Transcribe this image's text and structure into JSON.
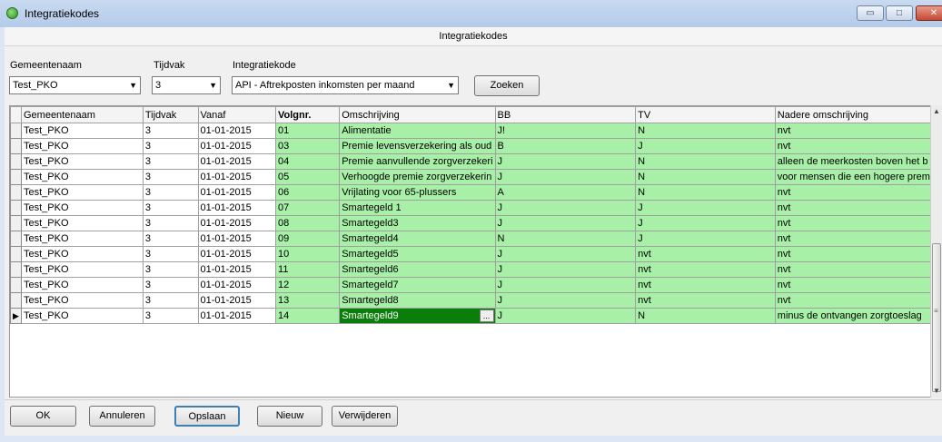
{
  "window": {
    "title": "Integratiekodes",
    "min_glyph": "▭",
    "max_glyph": "□",
    "close_glyph": "✕"
  },
  "header": {
    "title": "Integratiekodes"
  },
  "filters": {
    "gemeente": {
      "label": "Gemeentenaam",
      "value": "Test_PKO"
    },
    "tijdvak": {
      "label": "Tijdvak",
      "value": "3"
    },
    "integratiekode": {
      "label": "Integratiekode",
      "value": "API - Aftrekposten inkomsten per maand"
    },
    "search_label": "Zoeken",
    "dropdown_glyph": "▼"
  },
  "grid": {
    "columns": [
      "Gemeentenaam",
      "Tijdvak",
      "Vanaf",
      "Volgnr.",
      "Omschrijving",
      "BB",
      "TV",
      "Nadere omschrijving"
    ],
    "rows": [
      [
        "Test_PKO",
        "3",
        "01-01-2015",
        "01",
        "Alimentatie",
        "J!",
        "N",
        "nvt"
      ],
      [
        "Test_PKO",
        "3",
        "01-01-2015",
        "03",
        "Premie levensverzekering als oud",
        "B",
        "J",
        "nvt"
      ],
      [
        "Test_PKO",
        "3",
        "01-01-2015",
        "04",
        "Premie aanvullende zorgverzekeri",
        "J",
        "N",
        "alleen de meerkosten boven het b"
      ],
      [
        "Test_PKO",
        "3",
        "01-01-2015",
        "05",
        "Verhoogde premie zorgverzekerin",
        "J",
        "N",
        "voor mensen die een hogere prem"
      ],
      [
        "Test_PKO",
        "3",
        "01-01-2015",
        "06",
        "Vrijlating voor 65-plussers",
        "A",
        "N",
        "nvt"
      ],
      [
        "Test_PKO",
        "3",
        "01-01-2015",
        "07",
        "Smartegeld 1",
        "J",
        "J",
        "nvt"
      ],
      [
        "Test_PKO",
        "3",
        "01-01-2015",
        "08",
        "Smartegeld3",
        "J",
        "J",
        "nvt"
      ],
      [
        "Test_PKO",
        "3",
        "01-01-2015",
        "09",
        "Smartegeld4",
        "N",
        "J",
        "nvt"
      ],
      [
        "Test_PKO",
        "3",
        "01-01-2015",
        "10",
        "Smartegeld5",
        "J",
        "nvt",
        "nvt"
      ],
      [
        "Test_PKO",
        "3",
        "01-01-2015",
        "11",
        "Smartegeld6",
        "J",
        "nvt",
        "nvt"
      ],
      [
        "Test_PKO",
        "3",
        "01-01-2015",
        "12",
        "Smartegeld7",
        "J",
        "nvt",
        "nvt"
      ],
      [
        "Test_PKO",
        "3",
        "01-01-2015",
        "13",
        "Smartegeld8",
        "J",
        "nvt",
        "nvt"
      ],
      [
        "Test_PKO",
        "3",
        "01-01-2015",
        "14",
        "Smartegeld9",
        "J",
        "N",
        "minus de ontvangen zorgtoeslag"
      ]
    ],
    "active_row_index": 12,
    "row_pointer_glyph": "▶",
    "ellipsis_label": "...",
    "colors": {
      "editable": "#a8f0a8",
      "selected_cell": "#0b7d0b"
    }
  },
  "scrollbar": {
    "up_glyph": "▲",
    "down_glyph": "▼",
    "grip_glyph": "≡"
  },
  "buttons": {
    "ok": "OK",
    "cancel": "Annuleren",
    "save": "Opslaan",
    "new": "Nieuw",
    "delete": "Verwijderen"
  }
}
